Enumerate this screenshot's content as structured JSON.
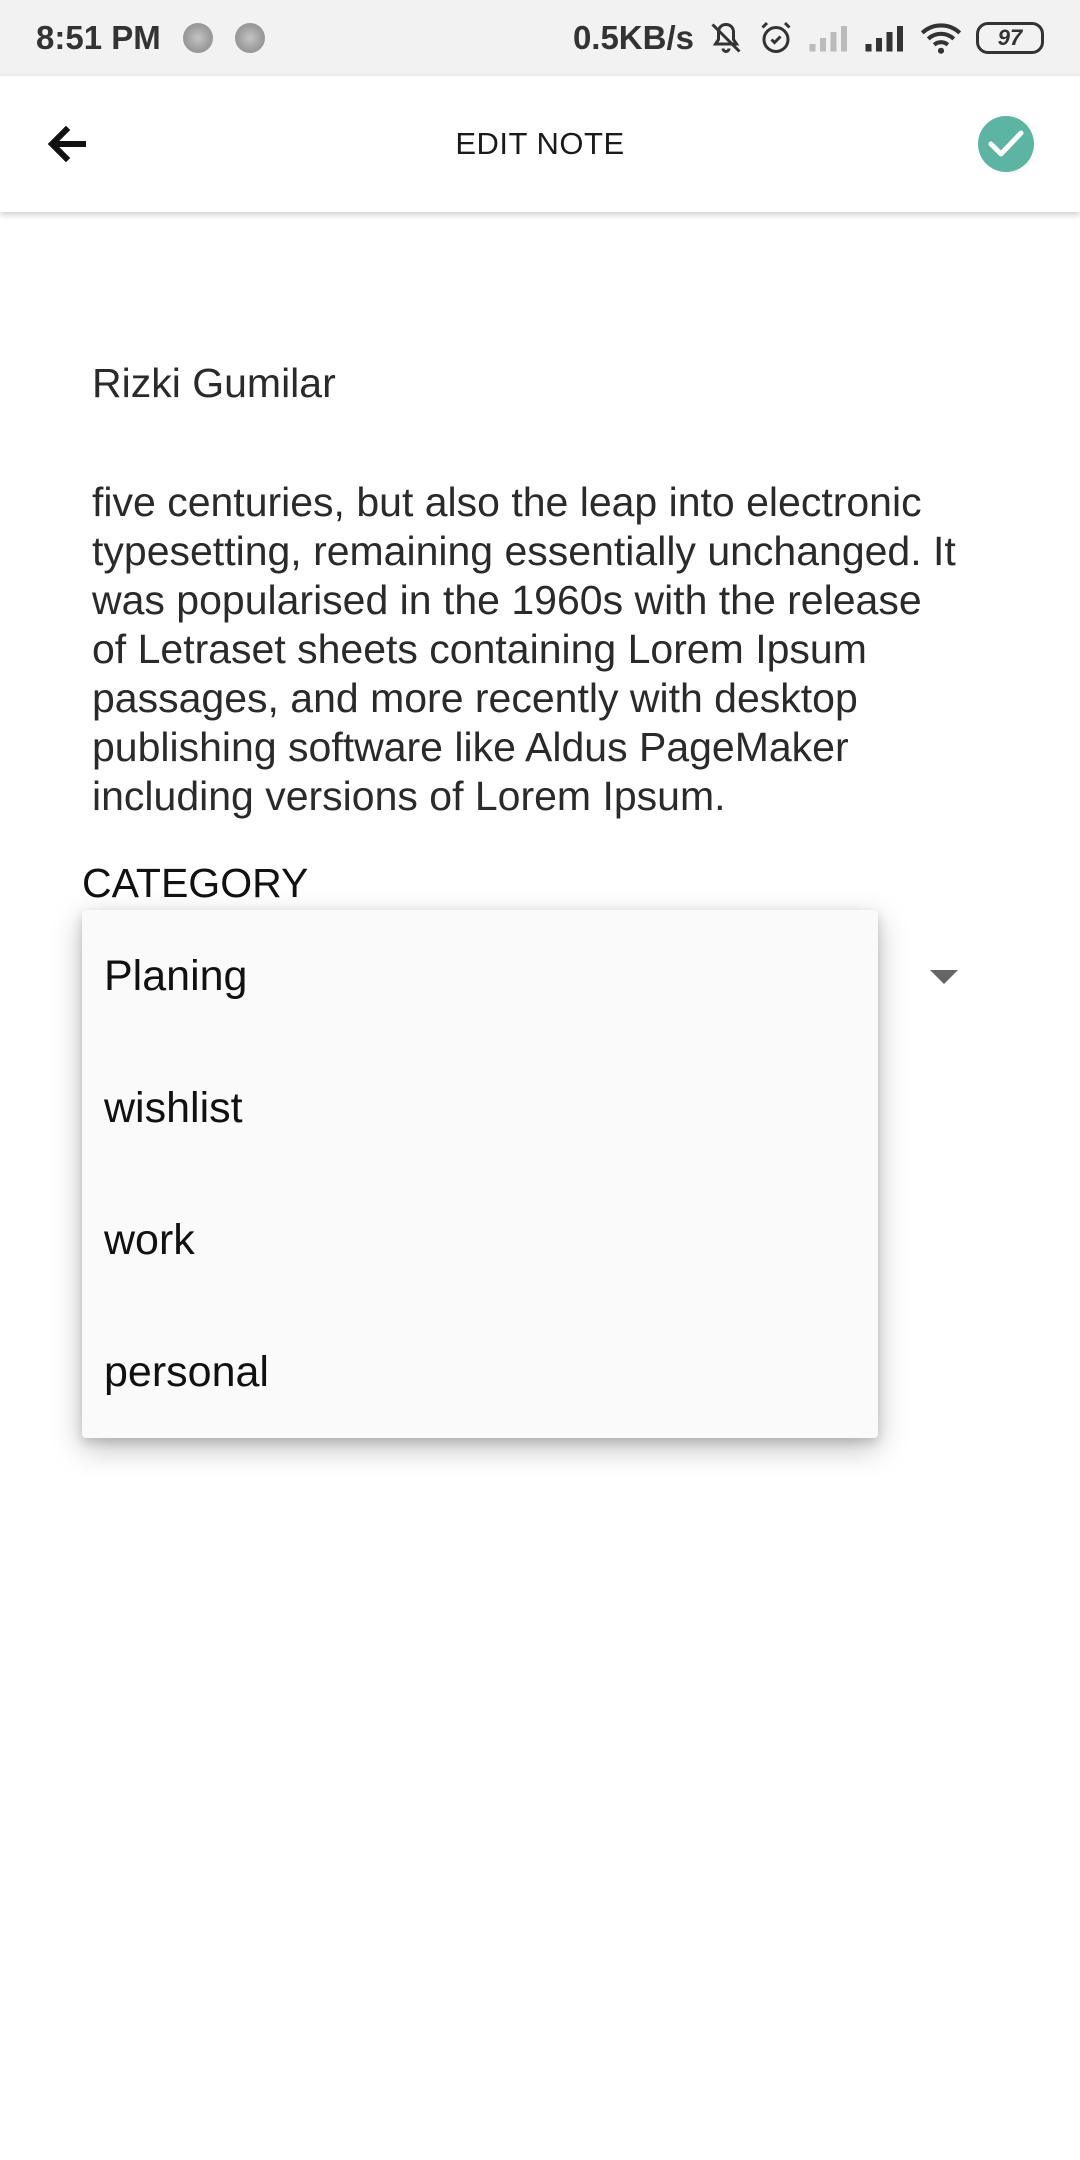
{
  "status_bar": {
    "time": "8:51 PM",
    "net_speed": "0.5KB/s",
    "battery": "97"
  },
  "app_bar": {
    "title": "EDIT NOTE"
  },
  "note": {
    "title": "Rizki Gumilar",
    "body": "five centuries, but also the leap into electronic\ntypesetting, remaining essentially unchanged. It\nwas popularised in the 1960s with the release\nof Letraset sheets containing Lorem Ipsum\npassages, and more recently with desktop\npublishing software like Aldus PageMaker\nincluding versions of Lorem Ipsum."
  },
  "category": {
    "label": "CATEGORY",
    "options": [
      "Planing",
      "wishlist",
      "work",
      "personal"
    ]
  },
  "colors": {
    "accent": "#5bb5a2",
    "status_bar_bg": "#f2f2f2"
  },
  "icons": {
    "back": "arrow-left-icon",
    "save": "check-icon",
    "dropdown": "caret-down-icon"
  }
}
